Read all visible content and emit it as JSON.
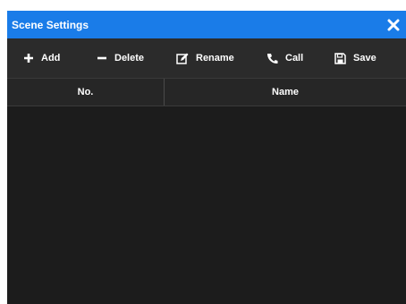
{
  "window": {
    "title": "Scene Settings",
    "close_icon": "close-icon"
  },
  "toolbar": {
    "buttons": [
      {
        "label": "Add",
        "icon": "plus-icon"
      },
      {
        "label": "Delete",
        "icon": "minus-icon"
      },
      {
        "label": "Rename",
        "icon": "edit-icon"
      },
      {
        "label": "Call",
        "icon": "phone-icon"
      },
      {
        "label": "Save",
        "icon": "floppy-disk-icon"
      }
    ]
  },
  "table": {
    "columns": [
      "No.",
      "Name"
    ],
    "rows": []
  },
  "colors": {
    "titlebar": "#1a7ce8",
    "toolbar": "#2b2b2b",
    "body": "#1c1c1c",
    "text": "#ffffff"
  }
}
